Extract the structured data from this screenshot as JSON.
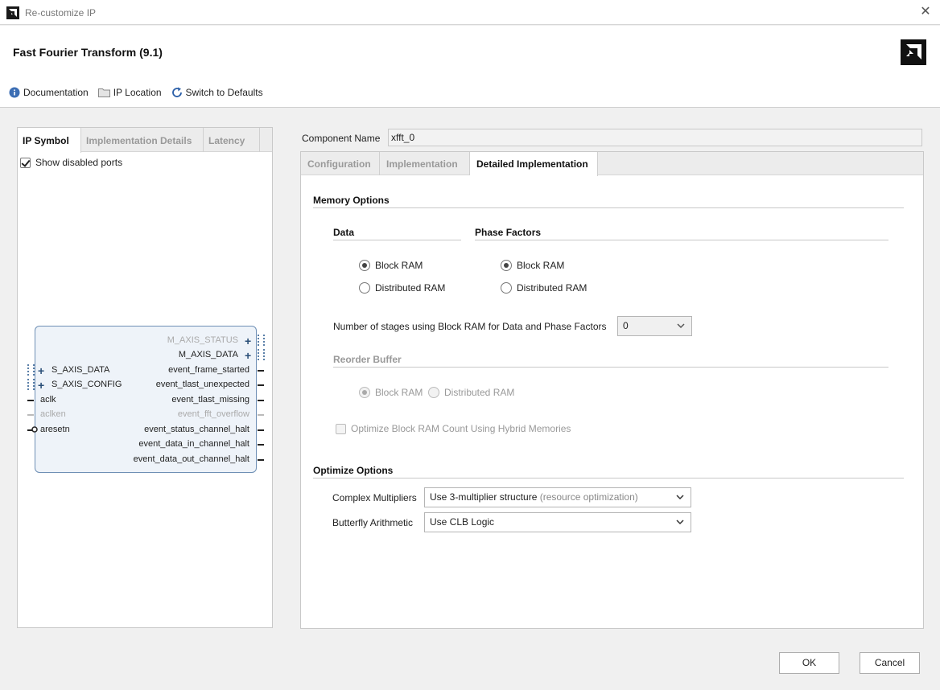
{
  "window": {
    "title": "Re-customize IP"
  },
  "header": {
    "ip_title": "Fast Fourier Transform (9.1)",
    "toolbar": {
      "documentation": "Documentation",
      "ip_location": "IP Location",
      "switch_defaults": "Switch to Defaults"
    }
  },
  "left_panel": {
    "tabs": [
      "IP Symbol",
      "Implementation Details",
      "Latency"
    ],
    "show_disabled_ports": "Show disabled ports",
    "symbol": {
      "right_ports": [
        "M_AXIS_STATUS",
        "M_AXIS_DATA",
        "event_frame_started",
        "event_tlast_unexpected",
        "event_tlast_missing",
        "event_fft_overflow",
        "event_status_channel_halt",
        "event_data_in_channel_halt",
        "event_data_out_channel_halt"
      ],
      "left_ports": [
        "S_AXIS_DATA",
        "S_AXIS_CONFIG",
        "aclk",
        "aclken",
        "aresetn"
      ]
    }
  },
  "component": {
    "label": "Component Name",
    "value": "xfft_0"
  },
  "right_panel": {
    "tabs": [
      "Configuration",
      "Implementation",
      "Detailed Implementation"
    ],
    "memory_options": {
      "title": "Memory Options",
      "data": {
        "title": "Data",
        "options": [
          "Block RAM",
          "Distributed RAM"
        ]
      },
      "phase": {
        "title": "Phase Factors",
        "options": [
          "Block RAM",
          "Distributed RAM"
        ]
      },
      "stages_label": "Number of stages using Block RAM for Data and Phase Factors",
      "stages_value": "0",
      "reorder": {
        "title": "Reorder Buffer",
        "options": [
          "Block RAM",
          "Distributed RAM"
        ]
      },
      "hybrid_label": "Optimize Block RAM Count Using Hybrid Memories"
    },
    "optimize_options": {
      "title": "Optimize Options",
      "complex_label": "Complex Multipliers",
      "complex_value": "Use 3-multiplier structure",
      "complex_hint": "(resource optimization)",
      "butterfly_label": "Butterfly Arithmetic",
      "butterfly_value": "Use CLB Logic"
    }
  },
  "buttons": {
    "ok": "OK",
    "cancel": "Cancel"
  }
}
